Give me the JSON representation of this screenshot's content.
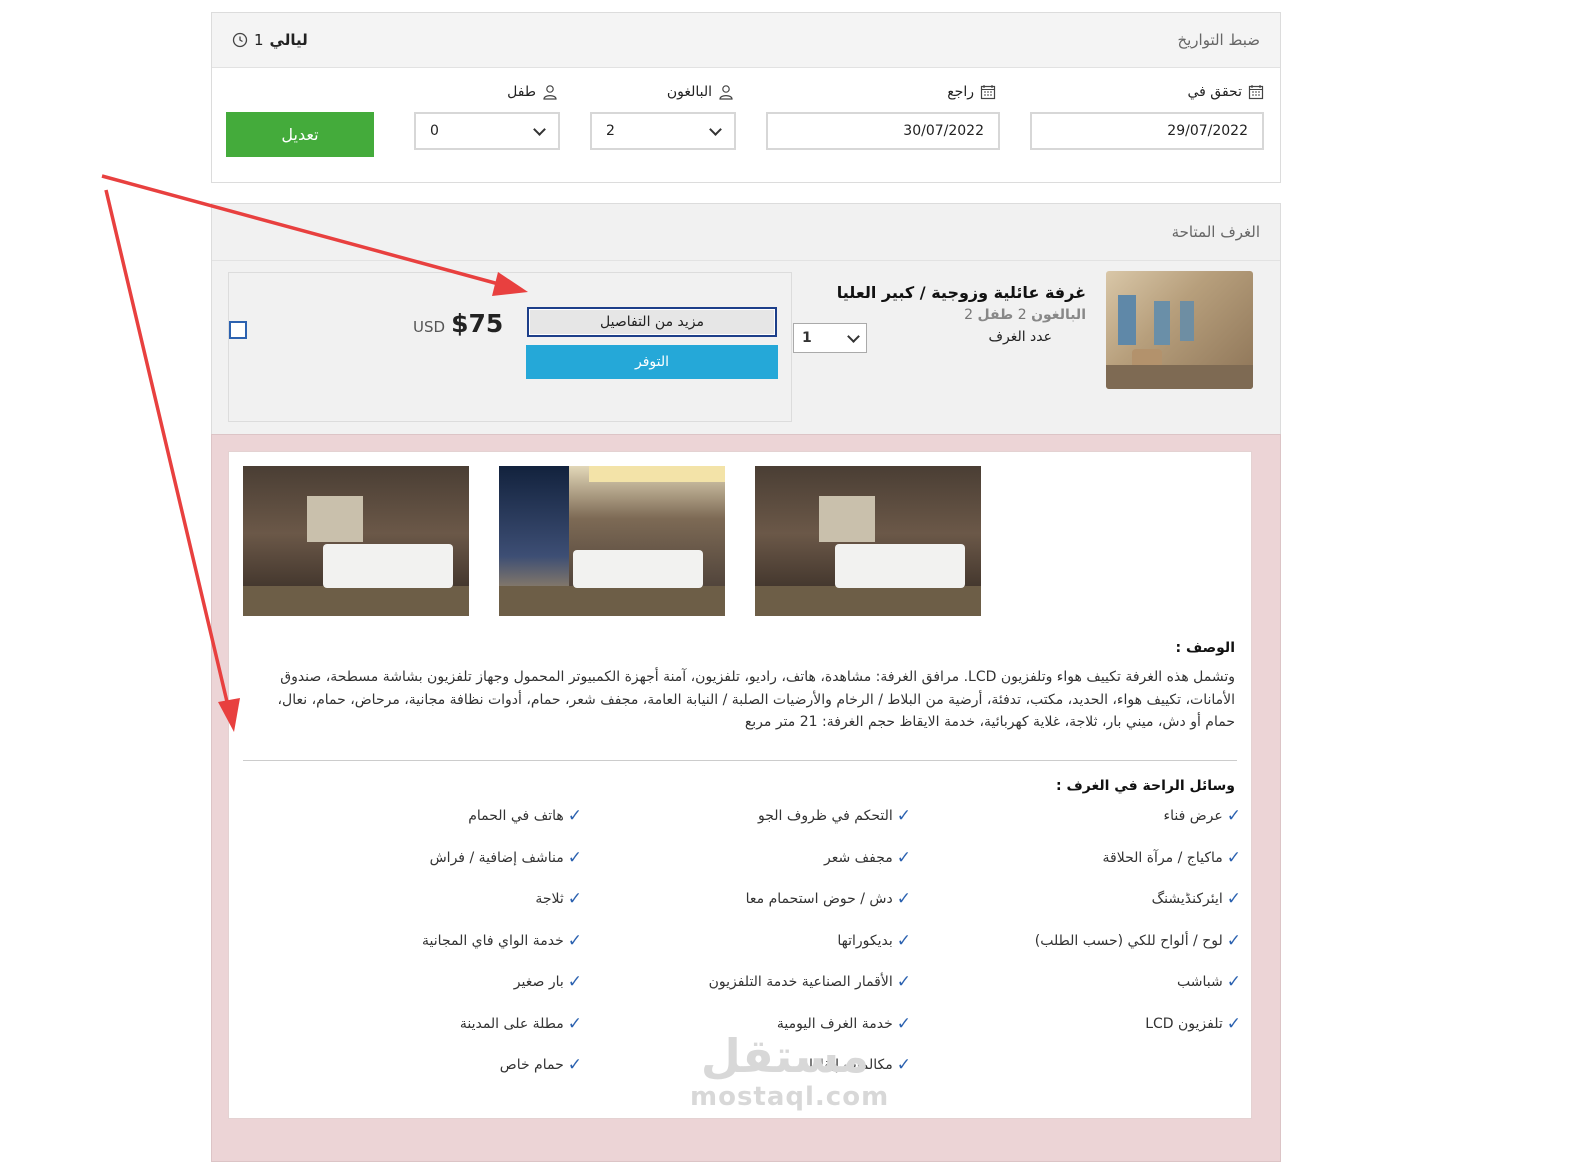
{
  "dates_panel": {
    "title": "ضبط التواريخ",
    "nights_label": "ليالي",
    "nights_value": "1",
    "checkin_label": "تحقق في",
    "checkin_value": "29/07/2022",
    "checkout_label": "راجع",
    "checkout_value": "30/07/2022",
    "adults_label": "البالغون",
    "adults_value": "2",
    "children_label": "طفل",
    "children_value": "0",
    "edit_button": "تعديل"
  },
  "rooms_panel": {
    "title": "الغرف المتاحة",
    "room": {
      "name": "غرفة عائلية وزوجية / كبير العليا",
      "adults_label": "البالغون",
      "adults_value": "2",
      "children_label": "طفل",
      "children_value": "2",
      "count_label": "عدد الغرف",
      "count_value": "1",
      "price_amount": "$75",
      "price_currency": "USD",
      "details_button": "مزيد من التفاصيل",
      "availability_button": "التوفر"
    }
  },
  "details": {
    "description_title": "الوصف :",
    "description_text": "وتشمل هذه الغرفة تكييف هواء وتلفزيون LCD. مرافق الغرفة: مشاهدة، هاتف، راديو، تلفزيون، آمنة أجهزة الكمبيوتر المحمول وجهاز تلفزيون بشاشة مسطحة، صندوق الأمانات، تكييف هواء، الحديد، مكتب، تدفئة، أرضية من البلاط / الرخام والأرضيات الصلبة / النيابة العامة، مجفف شعر، حمام، أدوات نظافة مجانية، مرحاض، حمام، نعال، حمام أو دش، ميني بار، ثلاجة، غلاية كهربائية، خدمة الايقاظ حجم الغرفة: 21 متر مربع",
    "amenities_title": "وسائل الراحة في الغرف :",
    "amenities_col1": [
      "عرض فناء",
      "ماكياج / مرآة الحلاقة",
      "ايئركنڈیشنگ",
      "لوح / ألواح للكي (حسب الطلب)",
      "شباشب",
      "تلفزيون LCD"
    ],
    "amenities_col2": [
      "التحكم في ظروف الجو",
      "مجفف شعر",
      "دش / حوض استحمام معا",
      "بديكوراتها",
      "الأقمار الصناعية خدمة التلفزيون",
      "خدمة الغرف اليومية",
      "مكالمات إيقاظ"
    ],
    "amenities_col3": [
      "هاتف في الحمام",
      "مناشف إضافية / فراش",
      "ثلاجة",
      "خدمة الواي فاي المجانية",
      "بار صغير",
      "مطلة على المدينة",
      "حمام خاص"
    ]
  },
  "watermark": {
    "arabic": "مستقل",
    "latin": "mostaql.com"
  },
  "colors": {
    "edit_button": "#44ab3b",
    "availability_button": "#25a8d8",
    "details_background": "#ecd4d6",
    "tick": "#2c62b0",
    "annotation_arrow": "#e8403f"
  },
  "icons": {
    "calendar": "calendar-icon",
    "user": "user-icon",
    "clock": "clock-icon",
    "check": "check-icon"
  }
}
